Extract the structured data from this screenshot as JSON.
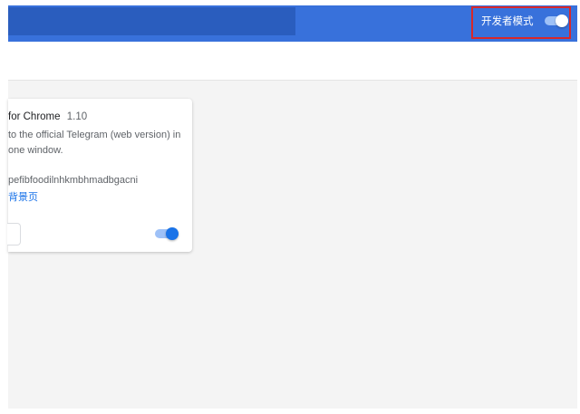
{
  "header": {
    "developer_mode_label": "开发者模式",
    "developer_mode_enabled": true
  },
  "extension_card": {
    "name": "for Chrome",
    "version": "1.10",
    "description_lines": [
      "to the official Telegram (web version) in",
      "one window."
    ],
    "id_text": "pefibfoodilnhkmbhmadbgacni",
    "background_page_link": "背景页",
    "enabled": true
  },
  "colors": {
    "header_bg": "#3871db",
    "search_bg": "#2a5dbe",
    "highlight_border": "#d8282a",
    "toggle_on": "#1a73e8",
    "content_bg": "#f4f4f4"
  }
}
